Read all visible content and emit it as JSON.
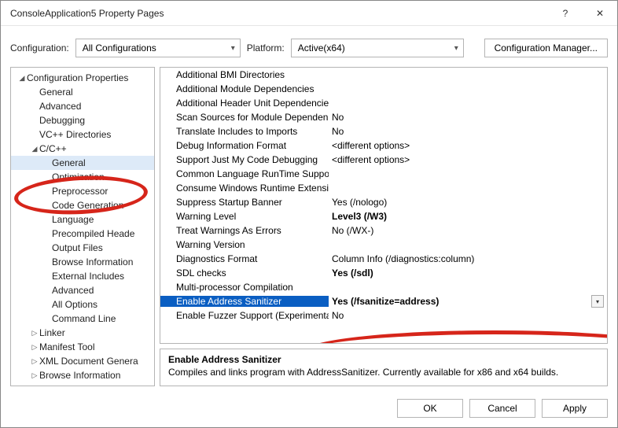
{
  "window": {
    "title": "ConsoleApplication5 Property Pages",
    "help_icon": "?",
    "close_icon": "✕"
  },
  "toolbar": {
    "configuration_label": "Configuration:",
    "configuration_value": "All Configurations",
    "platform_label": "Platform:",
    "platform_value": "Active(x64)",
    "config_manager_label": "Configuration Manager..."
  },
  "tree": [
    {
      "depth": 0,
      "tw": "◢",
      "label": "Configuration Properties"
    },
    {
      "depth": 1,
      "tw": "",
      "label": "General"
    },
    {
      "depth": 1,
      "tw": "",
      "label": "Advanced"
    },
    {
      "depth": 1,
      "tw": "",
      "label": "Debugging"
    },
    {
      "depth": 1,
      "tw": "",
      "label": "VC++ Directories"
    },
    {
      "depth": 1,
      "tw": "◢",
      "label": "C/C++"
    },
    {
      "depth": 2,
      "tw": "",
      "label": "General",
      "selected": true
    },
    {
      "depth": 2,
      "tw": "",
      "label": "Optimization"
    },
    {
      "depth": 2,
      "tw": "",
      "label": "Preprocessor"
    },
    {
      "depth": 2,
      "tw": "",
      "label": "Code Generation"
    },
    {
      "depth": 2,
      "tw": "",
      "label": "Language"
    },
    {
      "depth": 2,
      "tw": "",
      "label": "Precompiled Heade"
    },
    {
      "depth": 2,
      "tw": "",
      "label": "Output Files"
    },
    {
      "depth": 2,
      "tw": "",
      "label": "Browse Information"
    },
    {
      "depth": 2,
      "tw": "",
      "label": "External Includes"
    },
    {
      "depth": 2,
      "tw": "",
      "label": "Advanced"
    },
    {
      "depth": 2,
      "tw": "",
      "label": "All Options"
    },
    {
      "depth": 2,
      "tw": "",
      "label": "Command Line"
    },
    {
      "depth": 1,
      "tw": "▷",
      "label": "Linker"
    },
    {
      "depth": 1,
      "tw": "▷",
      "label": "Manifest Tool"
    },
    {
      "depth": 1,
      "tw": "▷",
      "label": "XML Document Genera"
    },
    {
      "depth": 1,
      "tw": "▷",
      "label": "Browse Information"
    }
  ],
  "grid": [
    {
      "name": "Additional BMI Directories",
      "value": ""
    },
    {
      "name": "Additional Module Dependencies",
      "value": ""
    },
    {
      "name": "Additional Header Unit Dependencies",
      "value": ""
    },
    {
      "name": "Scan Sources for Module Dependencies",
      "value": "No"
    },
    {
      "name": "Translate Includes to Imports",
      "value": "No"
    },
    {
      "name": "Debug Information Format",
      "value": "<different options>"
    },
    {
      "name": "Support Just My Code Debugging",
      "value": "<different options>"
    },
    {
      "name": "Common Language RunTime Support",
      "value": ""
    },
    {
      "name": "Consume Windows Runtime Extension",
      "value": ""
    },
    {
      "name": "Suppress Startup Banner",
      "value": "Yes (/nologo)"
    },
    {
      "name": "Warning Level",
      "value": "Level3 (/W3)",
      "bold": true
    },
    {
      "name": "Treat Warnings As Errors",
      "value": "No (/WX-)"
    },
    {
      "name": "Warning Version",
      "value": ""
    },
    {
      "name": "Diagnostics Format",
      "value": "Column Info (/diagnostics:column)"
    },
    {
      "name": "SDL checks",
      "value": "Yes (/sdl)",
      "bold": true
    },
    {
      "name": "Multi-processor Compilation",
      "value": ""
    },
    {
      "name": "Enable Address Sanitizer",
      "value": "Yes (/fsanitize=address)",
      "bold": true,
      "selected": true,
      "dropdown": true
    },
    {
      "name": "Enable Fuzzer Support (Experimental)",
      "value": "No"
    }
  ],
  "description": {
    "title": "Enable Address Sanitizer",
    "body": "Compiles and links program with AddressSanitizer. Currently available for x86 and x64 builds."
  },
  "buttons": {
    "ok": "OK",
    "cancel": "Cancel",
    "apply": "Apply"
  }
}
